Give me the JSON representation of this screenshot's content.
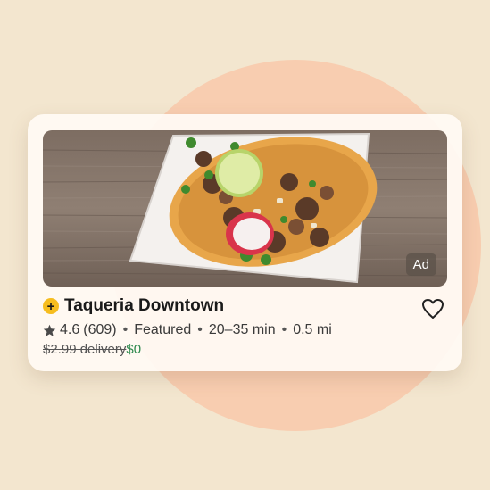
{
  "store": {
    "name": "Taqueria Downtown",
    "badge_icon": "plus-badge-icon",
    "ad_label": "Ad",
    "rating": "4.6",
    "review_count": "(609)",
    "featured": "Featured",
    "eta": "20–35 min",
    "distance": "0.5 mi",
    "delivery_old": "$2.99 delivery",
    "delivery_new": "$0",
    "separator": "•"
  },
  "colors": {
    "background": "#f3e6cf",
    "circle": "#f8cdb0",
    "badge": "#f6bd1f",
    "promo": "#2f8a4e"
  },
  "icons": {
    "favorite": "heart-outline-icon",
    "rating": "star-icon"
  }
}
